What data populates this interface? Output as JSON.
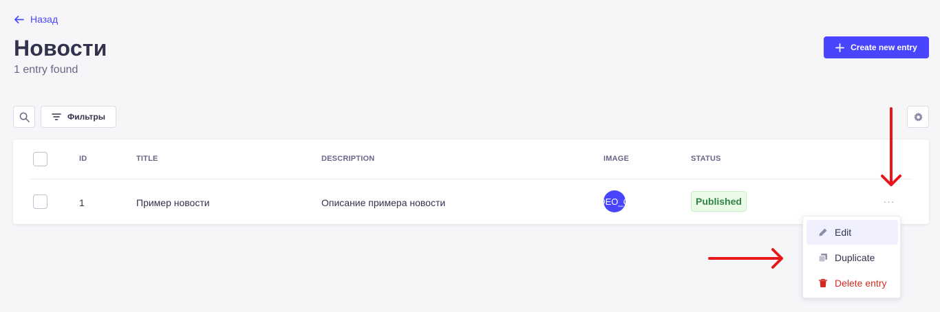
{
  "nav": {
    "back_label": "Назад"
  },
  "header": {
    "title": "Новости",
    "subtitle": "1 entry found",
    "create_label": "Create new entry"
  },
  "toolbar": {
    "filters_label": "Фильтры"
  },
  "table": {
    "columns": [
      "ID",
      "TITLE",
      "DESCRIPTION",
      "IMAGE",
      "STATUS"
    ],
    "rows": [
      {
        "id": "1",
        "title": "Пример новости",
        "description": "Описание примера новости",
        "image_text": "DEO_O",
        "status": "Published",
        "actions": "···"
      }
    ]
  },
  "menu": {
    "items": [
      {
        "label": "Edit",
        "icon": "pencil-icon"
      },
      {
        "label": "Duplicate",
        "icon": "duplicate-icon"
      },
      {
        "label": "Delete entry",
        "icon": "trash-icon"
      }
    ]
  },
  "colors": {
    "primary": "#4945ff",
    "danger": "#d02b20",
    "success_text": "#328048",
    "success_bg": "#eafbe7",
    "annotation_red": "#e8161b"
  }
}
